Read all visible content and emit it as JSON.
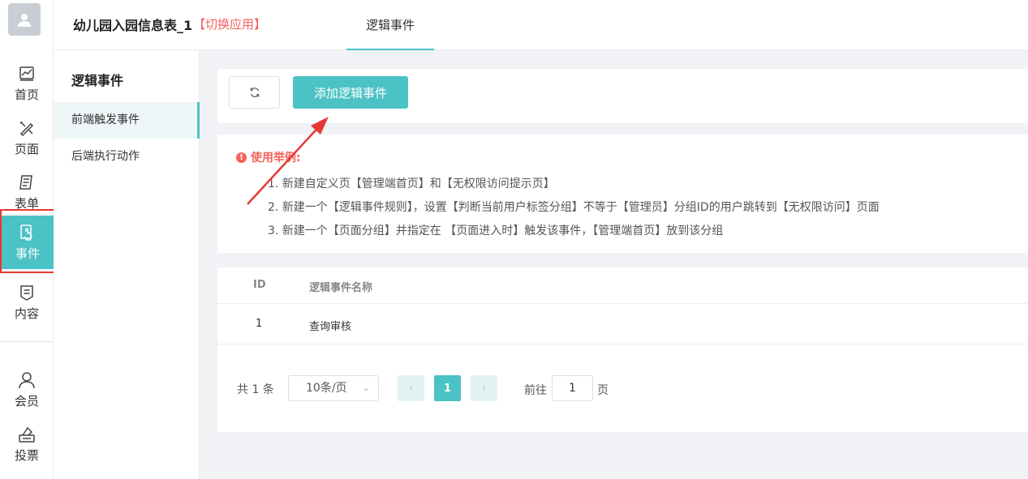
{
  "colors": {
    "accent": "#4bc2c5",
    "highlight": "#e53935",
    "warning": "#f5615c"
  },
  "rail": {
    "items": [
      {
        "label": "首页",
        "icon": "chart-icon"
      },
      {
        "label": "页面",
        "icon": "design-icon"
      },
      {
        "label": "表单",
        "icon": "form-icon"
      },
      {
        "label": "事件",
        "icon": "event-touch-icon",
        "active": true
      },
      {
        "label": "内容",
        "icon": "content-icon"
      },
      {
        "label": "会员",
        "icon": "user-icon"
      },
      {
        "label": "投票",
        "icon": "vote-icon"
      }
    ]
  },
  "header": {
    "app_title": "幼儿园入园信息表_1",
    "switch_app": "【切换应用】",
    "tab": "逻辑事件"
  },
  "submenu": {
    "title": "逻辑事件",
    "items": [
      {
        "label": "前端触发事件",
        "active": true
      },
      {
        "label": "后端执行动作"
      }
    ]
  },
  "toolbar": {
    "add_button": "添加逻辑事件"
  },
  "usage": {
    "title": "使用举例:",
    "lines": [
      "1. 新建自定义页【管理端首页】和【无权限访问提示页】",
      "2. 新建一个【逻辑事件规则】，设置【判断当前用户标签分组】不等于【管理员】分组ID的用户跳转到【无权限访问】页面",
      "3. 新建一个【页面分组】并指定在 【页面进入时】触发该事件，【管理端首页】放到该分组"
    ]
  },
  "table": {
    "columns": [
      "ID",
      "逻辑事件名称"
    ],
    "rows": [
      {
        "id": "1",
        "name": "查询审核"
      }
    ]
  },
  "pagination": {
    "total": "共 1 条",
    "page_size": "10条/页",
    "current_page": "1",
    "goto_label": "前往",
    "goto_value": "1",
    "goto_suffix": "页"
  }
}
